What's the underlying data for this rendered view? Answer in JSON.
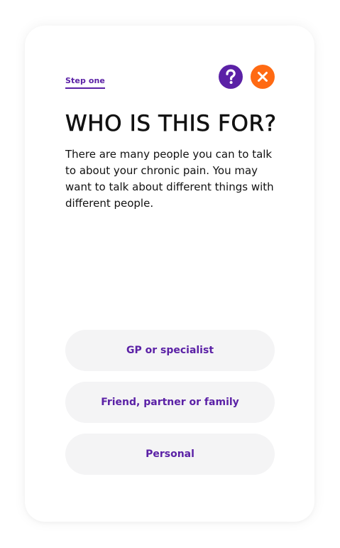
{
  "header": {
    "step_label": "Step one",
    "help_icon": "question-mark-icon",
    "close_icon": "close-x-icon"
  },
  "main": {
    "title": "WHO IS THIS FOR?",
    "description": "There are many people you can to talk to about your chronic pain. You may want to talk about different things with different people."
  },
  "options": [
    {
      "label": "GP or specialist"
    },
    {
      "label": "Friend, partner or family"
    },
    {
      "label": "Personal"
    }
  ],
  "colors": {
    "brand_purple": "#5b21a6",
    "accent_orange": "#ff6a13",
    "option_background": "#f4f4f5"
  }
}
